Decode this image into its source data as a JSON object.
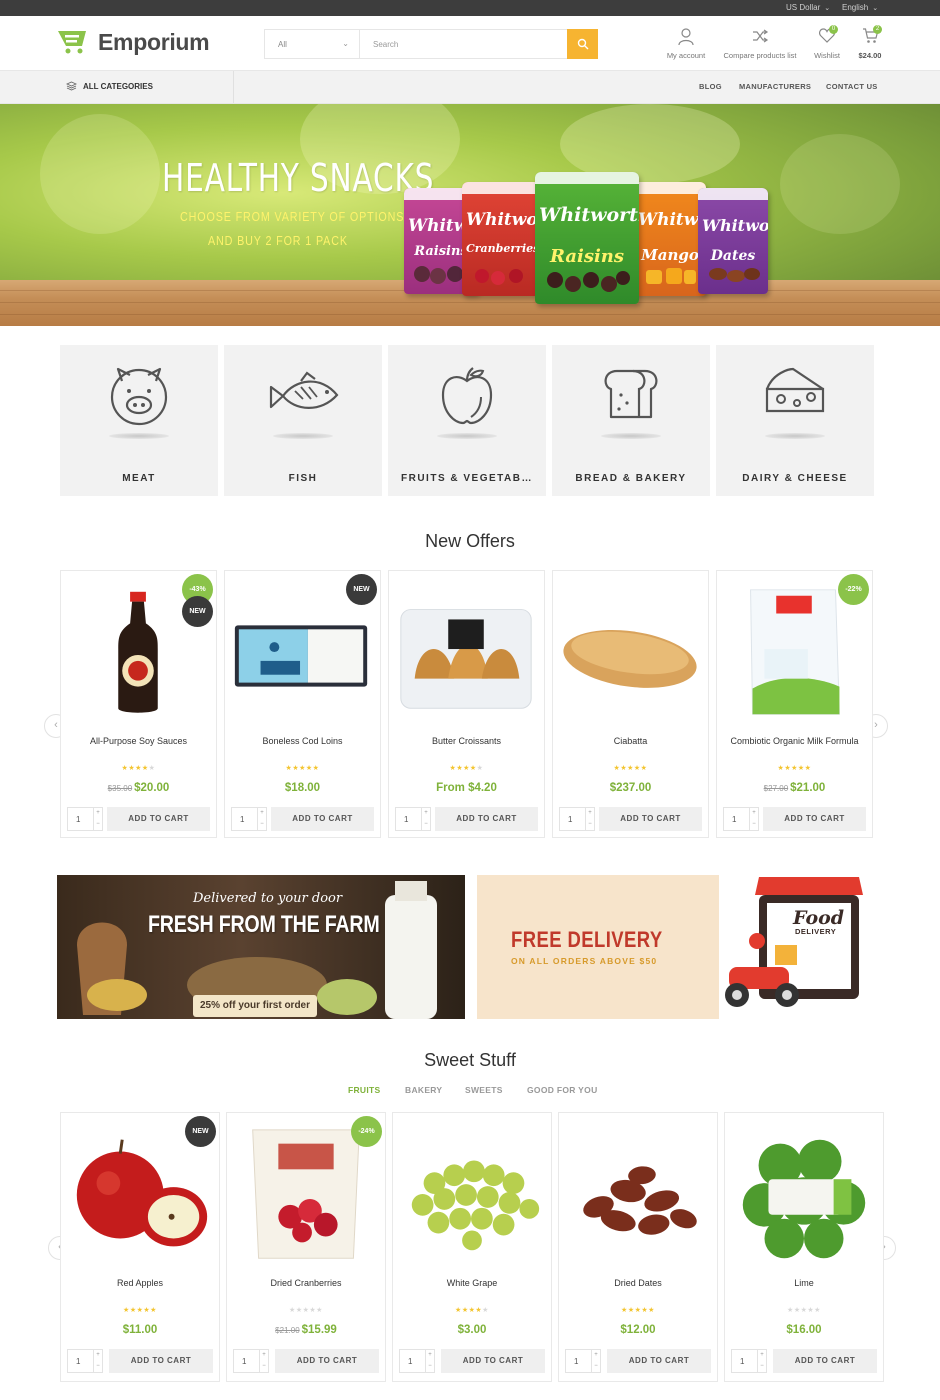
{
  "topbar": {
    "currency": "US Dollar",
    "language": "English"
  },
  "header": {
    "brand": "Emporium",
    "search": {
      "category": "All",
      "placeholder": "Search"
    },
    "my_account": "My account",
    "compare": "Compare products list",
    "wishlist": "Wishlist",
    "wishlist_count": "0",
    "cart_total": "$24.00",
    "cart_count": "2"
  },
  "nav": {
    "all_categories": "ALL CATEGORIES",
    "links": [
      "BLOG",
      "MANUFACTURERS",
      "CONTACT US"
    ]
  },
  "hero": {
    "title": "HEALTHY SNACKS",
    "subtitle_1": "CHOOSE FROM VARIETY OF OPTIONS",
    "subtitle_2": "AND BUY 2 FOR 1 PACK",
    "brand": "Whitworths",
    "packs": [
      "Raisins",
      "Cranberries",
      "Raisins",
      "Mango",
      "Dates"
    ]
  },
  "categories": [
    {
      "label": "MEAT",
      "icon": "pig-icon"
    },
    {
      "label": "FISH",
      "icon": "fish-icon"
    },
    {
      "label": "FRUITS & VEGETAB…",
      "icon": "apple-icon"
    },
    {
      "label": "BREAD & BAKERY",
      "icon": "bread-icon"
    },
    {
      "label": "DAIRY & CHEESE",
      "icon": "cheese-icon"
    }
  ],
  "new_offers": {
    "title": "New Offers",
    "add_label": "ADD TO CART",
    "products": [
      {
        "name": "All-Purpose Soy Sauces",
        "rating": 4,
        "old_price": "$35.00",
        "price": "$20.00",
        "qty": "1",
        "badges": [
          "-43%",
          "NEW"
        ]
      },
      {
        "name": "Boneless Cod Loins",
        "rating": 5,
        "old_price": "",
        "price": "$18.00",
        "qty": "1",
        "badges": [
          "NEW"
        ]
      },
      {
        "name": "Butter Croissants",
        "rating": 4,
        "old_price": "",
        "price": "From $4.20",
        "qty": "1",
        "badges": []
      },
      {
        "name": "Ciabatta",
        "rating": 5,
        "old_price": "",
        "price": "$237.00",
        "qty": "1",
        "badges": []
      },
      {
        "name": "Combiotic Organic Milk Formula",
        "rating": 5,
        "old_price": "$27.00",
        "price": "$21.00",
        "qty": "1",
        "badges": [
          "-22%"
        ]
      }
    ]
  },
  "banners": {
    "farm_script": "Delivered to your door",
    "farm_title": "FRESH FROM THE FARM",
    "farm_offer": "25% off your first order",
    "delivery_title": "FREE DELIVERY",
    "delivery_sub": "ON ALL ORDERS ABOVE $50",
    "food_sign_1": "Food",
    "food_sign_2": "DELIVERY"
  },
  "sweet_stuff": {
    "title": "Sweet Stuff",
    "tabs": [
      "FRUITS",
      "BAKERY",
      "SWEETS",
      "GOOD FOR YOU"
    ],
    "add_label": "ADD TO CART",
    "products": [
      {
        "name": "Red Apples",
        "rating": 5,
        "old_price": "",
        "price": "$11.00",
        "qty": "1",
        "badges": [
          "NEW"
        ]
      },
      {
        "name": "Dried Cranberries",
        "rating": 0,
        "old_price": "$21.00",
        "price": "$15.99",
        "qty": "1",
        "badges": [
          "-24%"
        ]
      },
      {
        "name": "White Grape",
        "rating": 4,
        "old_price": "",
        "price": "$3.00",
        "qty": "1",
        "badges": []
      },
      {
        "name": "Dried Dates",
        "rating": 5,
        "old_price": "",
        "price": "$12.00",
        "qty": "1",
        "badges": []
      },
      {
        "name": "Lime",
        "rating": 0,
        "old_price": "",
        "price": "$16.00",
        "qty": "1",
        "badges": []
      }
    ]
  },
  "colors": {
    "accent_green": "#8bc34a",
    "search_button": "#f6b431",
    "topbar": "#3d3d3d"
  }
}
